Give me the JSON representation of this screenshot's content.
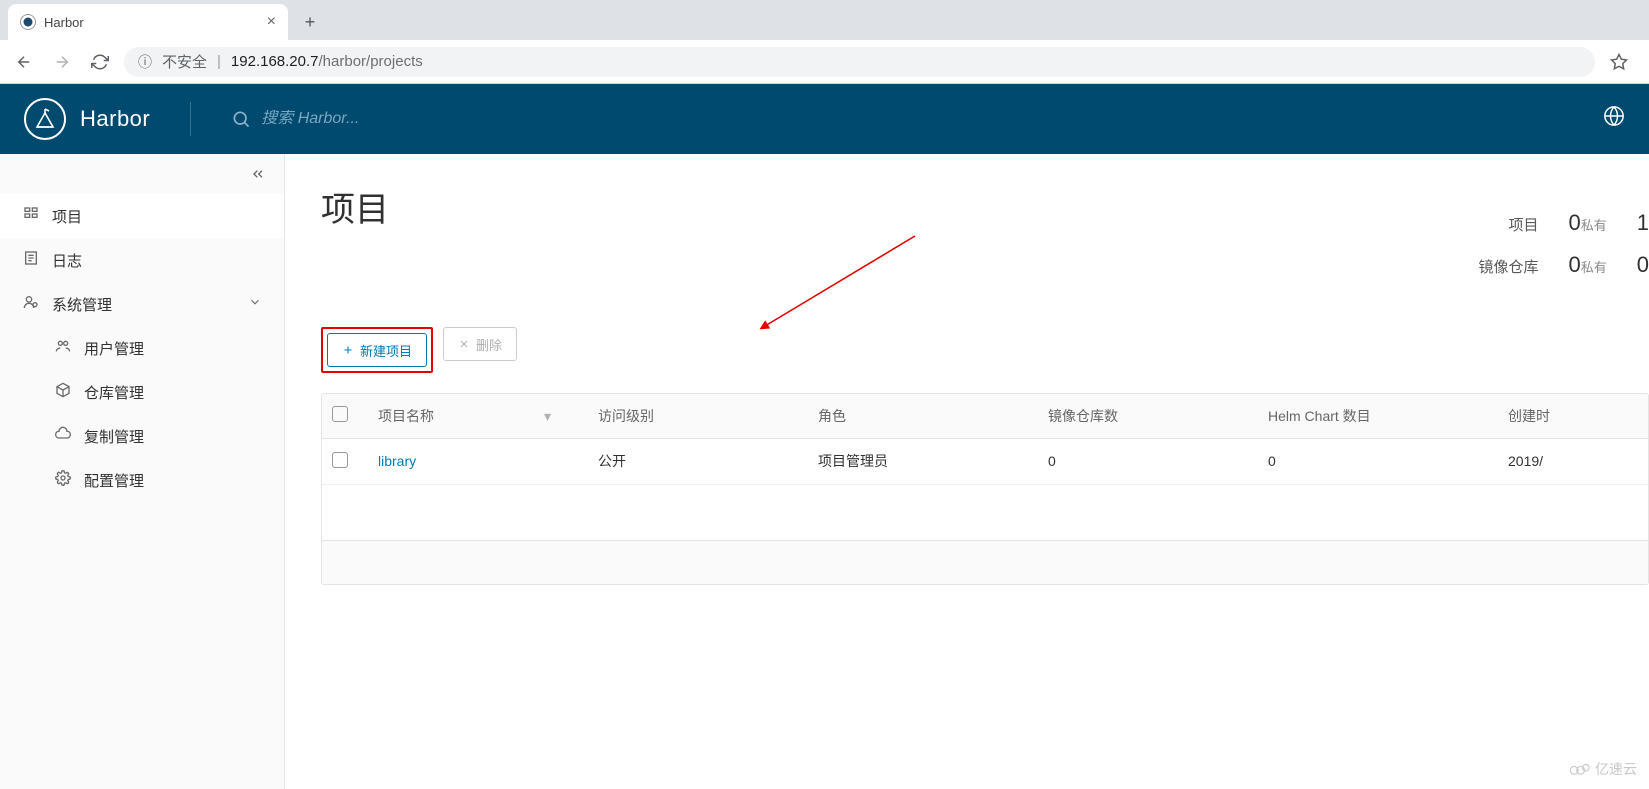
{
  "browser": {
    "tab_title": "Harbor",
    "insecure_label": "不安全",
    "url_host": "192.168.20.7",
    "url_path": "/harbor/projects"
  },
  "header": {
    "product_name": "Harbor",
    "search_placeholder": "搜索 Harbor..."
  },
  "sidebar": {
    "items": [
      {
        "label": "项目",
        "icon": "projects-icon",
        "active": true
      },
      {
        "label": "日志",
        "icon": "logs-icon"
      },
      {
        "label": "系统管理",
        "icon": "admin-icon",
        "expandable": true
      },
      {
        "label": "用户管理",
        "icon": "users-icon",
        "sub": true
      },
      {
        "label": "仓库管理",
        "icon": "repo-icon",
        "sub": true
      },
      {
        "label": "复制管理",
        "icon": "replication-icon",
        "sub": true
      },
      {
        "label": "配置管理",
        "icon": "config-icon",
        "sub": true
      }
    ]
  },
  "main": {
    "title": "项目",
    "summary": {
      "projects_label": "项目",
      "projects_private_count": "0",
      "projects_private_label": "私有",
      "projects_total_partial": "1",
      "repos_label": "镜像仓库",
      "repos_private_count": "0",
      "repos_private_label": "私有",
      "repos_total_partial": "0"
    },
    "actions": {
      "new_project": "新建项目",
      "delete": "删除"
    },
    "table": {
      "columns": {
        "name": "项目名称",
        "access": "访问级别",
        "role": "角色",
        "repo_count": "镜像仓库数",
        "helm_count": "Helm Chart 数目",
        "created": "创建时"
      },
      "rows": [
        {
          "name": "library",
          "access": "公开",
          "role": "项目管理员",
          "repo_count": "0",
          "helm_count": "0",
          "created": "2019/"
        }
      ]
    }
  },
  "watermark": "亿速云"
}
